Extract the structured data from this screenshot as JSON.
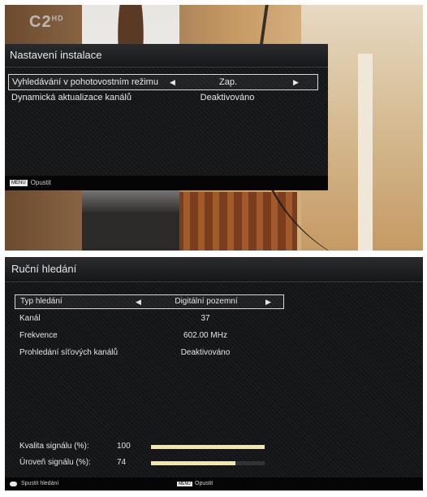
{
  "screen1": {
    "channel_logo": "C2",
    "channel_logo_sup": "HD",
    "title": "Nastavení instalace",
    "rows": [
      {
        "label": "Vyhledávání v pohotovostním režimu",
        "value": "Zap.",
        "selected": true
      },
      {
        "label": "Dynamická aktualizace kanálů",
        "value": "Deaktivováno",
        "selected": false
      }
    ],
    "footer": {
      "key": "MENU",
      "label": "Opustit"
    }
  },
  "screen2": {
    "title": "Ruční hledání",
    "rows": [
      {
        "label": "Typ hledání",
        "value": "Digitální pozemní",
        "selected": true
      },
      {
        "label": "Kanál",
        "value": "37",
        "selected": false
      },
      {
        "label": "Frekvence",
        "value": "602.00 MHz",
        "selected": false
      },
      {
        "label": "Prohledání síťových kanálů",
        "value": "Deaktivováno",
        "selected": false
      }
    ],
    "signal": [
      {
        "label": "Kvalita signálu (%):",
        "value": "100",
        "level": 1.0
      },
      {
        "label": "Úroveň signálu (%):",
        "value": "74",
        "level": 0.74
      }
    ],
    "footer": {
      "ok_label": "Spustit hledání",
      "key": "MENU",
      "label": "Opustit"
    }
  },
  "arrows": {
    "left": "◀",
    "right": "▶"
  },
  "colors": {
    "signal_bar": "#f0e7a8",
    "panel_bg": "#17181a"
  }
}
